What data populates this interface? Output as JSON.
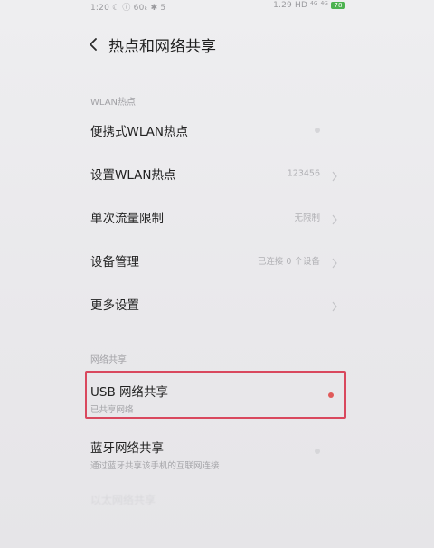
{
  "status_bar": {
    "left": "1:20 ☾ ⓘ 60ₖ ✱ 5",
    "right": "1.29 HD ⁴ᴳ ⁴ᴳ",
    "battery": "78"
  },
  "header": {
    "title": "热点和网络共享"
  },
  "wlan_section": {
    "label": "WLAN热点",
    "items": [
      {
        "title": "便携式WLAN热点",
        "value": "",
        "control": "toggle",
        "toggle_on": false
      },
      {
        "title": "设置WLAN热点",
        "value": "123456",
        "control": "chevron"
      },
      {
        "title": "单次流量限制",
        "value": "无限制",
        "control": "chevron"
      },
      {
        "title": "设备管理",
        "value": "已连接 0 个设备",
        "control": "chevron"
      },
      {
        "title": "更多设置",
        "value": "",
        "control": "chevron"
      }
    ]
  },
  "sharing_section": {
    "label": "网络共享",
    "items": [
      {
        "title": "USB 网络共享",
        "subtitle": "已共享网络",
        "control": "toggle",
        "toggle_on": true,
        "highlighted": true
      },
      {
        "title": "蓝牙网络共享",
        "subtitle": "通过蓝牙共享该手机的互联网连接",
        "control": "toggle",
        "toggle_on": false
      }
    ]
  },
  "faded_row": {
    "title": "以太网络共享"
  },
  "colors": {
    "accent": "#e05a5a",
    "highlight_border": "#d9485e",
    "background": "#ececee"
  }
}
